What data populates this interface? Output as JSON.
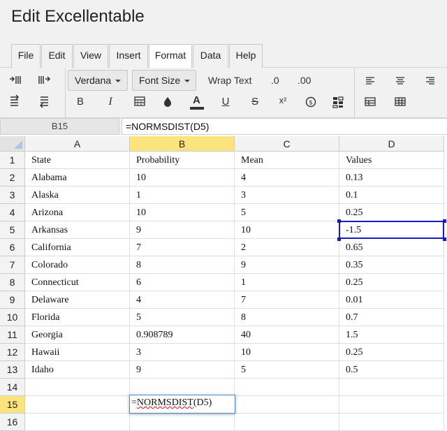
{
  "app": {
    "title": "Edit Excellentable"
  },
  "menu": {
    "tabs": [
      {
        "label": "File"
      },
      {
        "label": "Edit"
      },
      {
        "label": "View"
      },
      {
        "label": "Insert"
      },
      {
        "label": "Format"
      },
      {
        "label": "Data"
      },
      {
        "label": "Help"
      }
    ],
    "active_tab": "Format"
  },
  "toolbar": {
    "font_family": "Verdana",
    "font_size": "Font Size",
    "wrap_text": "Wrap Text",
    "decrease_decimal": ".0",
    "increase_decimal": ".00",
    "bold": "B",
    "italic": "I",
    "text_color": "A",
    "underline": "U",
    "strikethrough": "S",
    "superscript": "x²",
    "icons": [
      "indent-increase-icon",
      "indent-decrease-icon",
      "align-left-icon",
      "align-center-icon",
      "align-right-icon",
      "borders-icon",
      "fill-color-icon",
      "currency-icon",
      "conditional-format-icon",
      "table-icon",
      "grid-icon"
    ],
    "accent_color": "#1a1ac0",
    "selected_header_color": "#fbe37e"
  },
  "formula_bar": {
    "cell_ref": "B15",
    "formula": "=NORMSDIST(D5)"
  },
  "sheet": {
    "columns": [
      "A",
      "B",
      "C",
      "D"
    ],
    "selected_column": "B",
    "selected_row": "15",
    "rows": [
      {
        "num": "1",
        "cells": [
          "State",
          "Probability",
          "Mean",
          "Values"
        ]
      },
      {
        "num": "2",
        "cells": [
          "Alabama",
          "10",
          "4",
          "0.13"
        ]
      },
      {
        "num": "3",
        "cells": [
          "Alaska",
          "1",
          "3",
          "0.1"
        ]
      },
      {
        "num": "4",
        "cells": [
          "Arizona",
          "10",
          "5",
          "0.25"
        ]
      },
      {
        "num": "5",
        "cells": [
          "Arkansas",
          "9",
          "10",
          "-1.5"
        ]
      },
      {
        "num": "6",
        "cells": [
          "California",
          "7",
          "2",
          "0.65"
        ]
      },
      {
        "num": "7",
        "cells": [
          "Colorado",
          "8",
          "9",
          "0.35"
        ]
      },
      {
        "num": "8",
        "cells": [
          "Connecticut",
          "6",
          "1",
          "0.25"
        ]
      },
      {
        "num": "9",
        "cells": [
          "Delaware",
          "4",
          "7",
          "0.01"
        ]
      },
      {
        "num": "10",
        "cells": [
          "Florida",
          "5",
          "8",
          "0.7"
        ]
      },
      {
        "num": "11",
        "cells": [
          "Georgia",
          "0.908789",
          "40",
          "1.5"
        ]
      },
      {
        "num": "12",
        "cells": [
          "Hawaii",
          "3",
          "10",
          "0.25"
        ]
      },
      {
        "num": "13",
        "cells": [
          "Idaho",
          "9",
          "5",
          "0.5"
        ]
      },
      {
        "num": "14",
        "cells": [
          "",
          "",
          "",
          ""
        ]
      },
      {
        "num": "15",
        "cells": [
          "",
          "",
          "",
          ""
        ]
      },
      {
        "num": "16",
        "cells": [
          "",
          "",
          "",
          ""
        ]
      }
    ],
    "highlighted_cell": "D5",
    "editor": {
      "cell": "B15",
      "prefix": "=",
      "function": "NORMSDIST",
      "args": "(D5)"
    }
  }
}
